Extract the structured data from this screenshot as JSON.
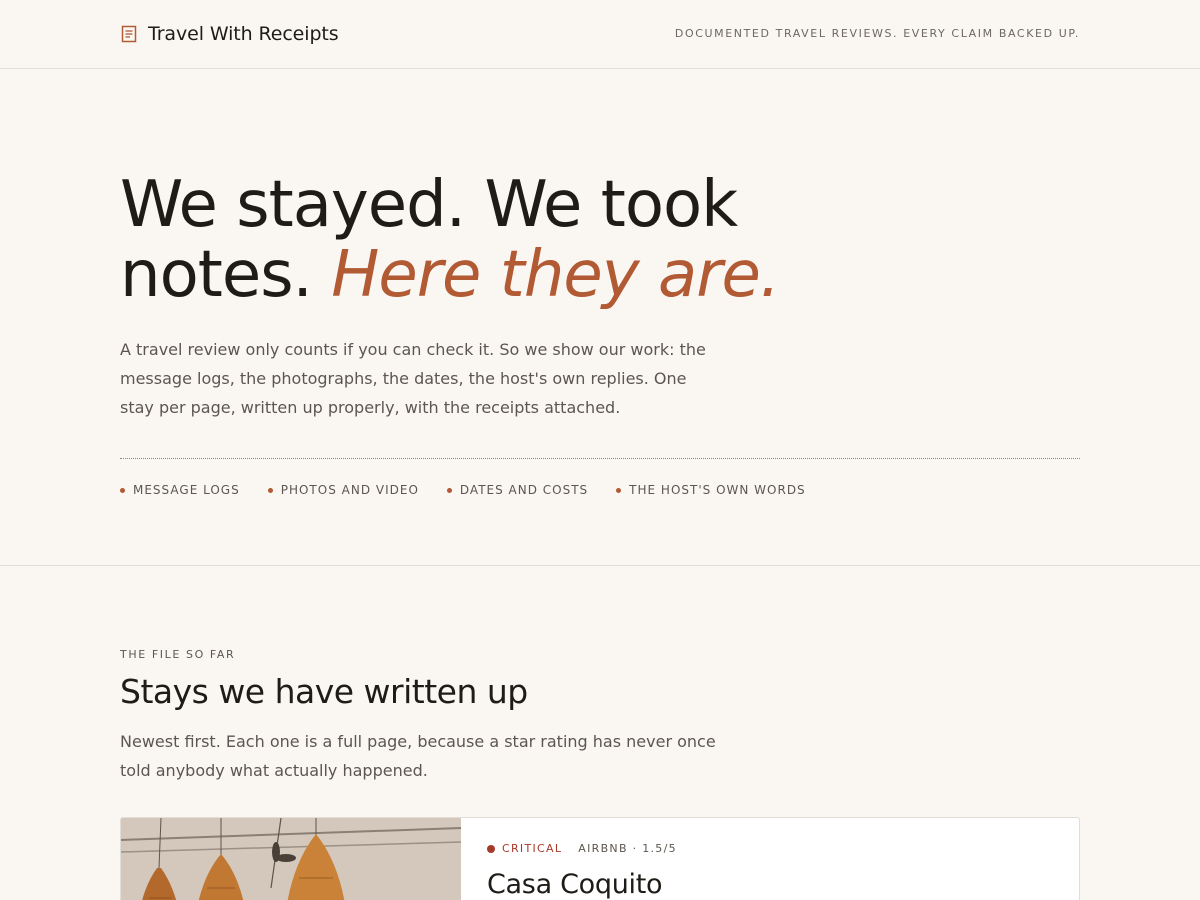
{
  "header": {
    "brand_name": "Travel With Receipts",
    "brand_icon": "receipt-icon",
    "tagline": "DOCUMENTED TRAVEL REVIEWS. EVERY CLAIM BACKED UP."
  },
  "hero": {
    "title_plain": "We stayed. We took notes.",
    "title_accent": "Here they are.",
    "lede": "A travel review only counts if you can check it. So we show our work: the message logs, the photographs, the dates, the host's own replies. One stay per page, written up properly, with the receipts attached.",
    "evidence": [
      "MESSAGE LOGS",
      "PHOTOS AND VIDEO",
      "DATES AND COSTS",
      "THE HOST'S OWN WORDS"
    ]
  },
  "stays": {
    "eyebrow": "THE FILE SO FAR",
    "title": "Stays we have written up",
    "lede": "Newest first. Each one is a full page, because a star rating has never once told anybody what actually happened.",
    "items": [
      {
        "verdict": "CRITICAL",
        "platform": "AIRBNB · 1.5/5",
        "title": "Casa Coquito"
      }
    ]
  },
  "colors": {
    "background": "#faf7f3",
    "accent": "#b15a33",
    "critical": "#a63a2a",
    "text": "#1f1b17",
    "muted": "#5c564f"
  }
}
